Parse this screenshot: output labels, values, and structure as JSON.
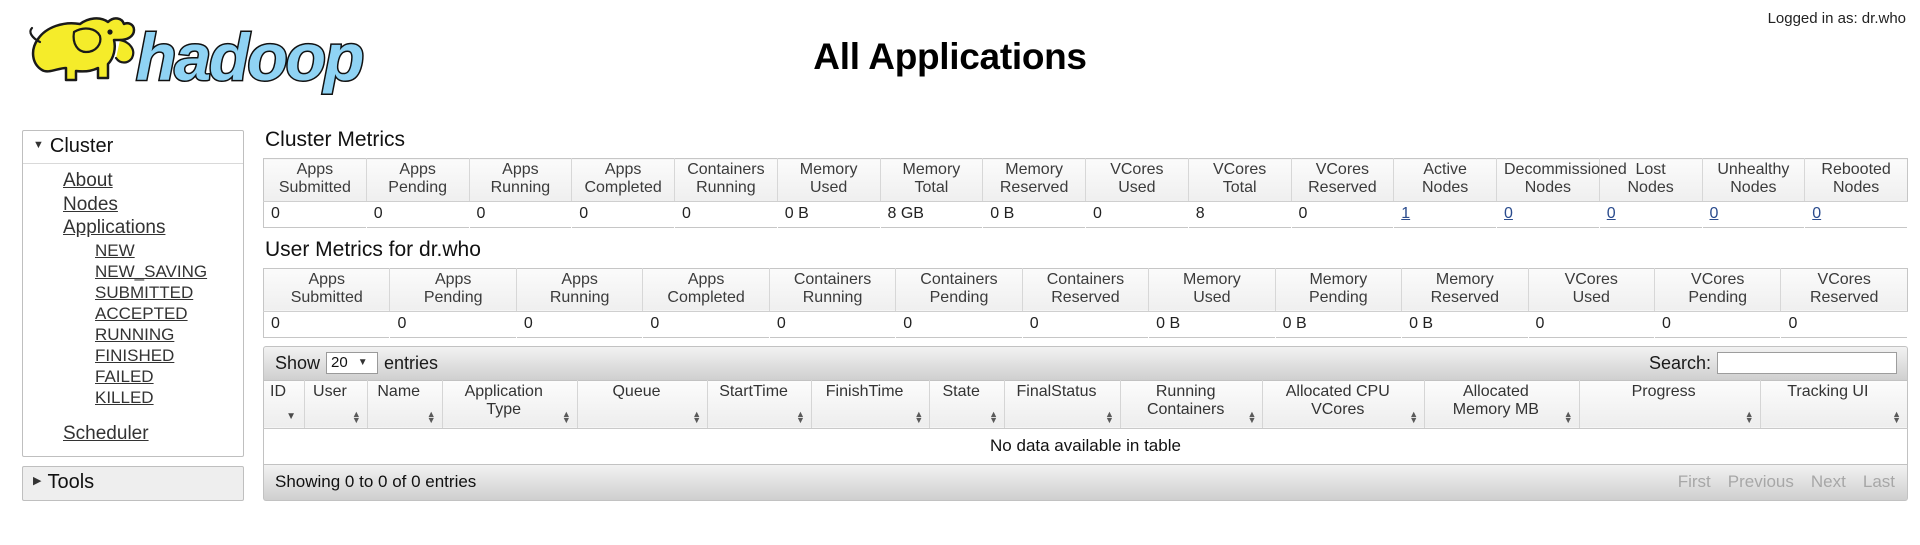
{
  "header": {
    "logged_in": "Logged in as: dr.who",
    "title": "All Applications",
    "logo_alt": "hadoop-logo"
  },
  "sidebar": {
    "cluster": {
      "label": "Cluster",
      "items": [
        {
          "label": "About"
        },
        {
          "label": "Nodes"
        },
        {
          "label": "Applications"
        }
      ],
      "app_states": [
        {
          "label": "NEW"
        },
        {
          "label": "NEW_SAVING"
        },
        {
          "label": "SUBMITTED"
        },
        {
          "label": "ACCEPTED"
        },
        {
          "label": "RUNNING"
        },
        {
          "label": "FINISHED"
        },
        {
          "label": "FAILED"
        },
        {
          "label": "KILLED"
        }
      ],
      "scheduler": {
        "label": "Scheduler"
      }
    },
    "tools": {
      "label": "Tools"
    }
  },
  "cluster_metrics": {
    "title": "Cluster Metrics",
    "columns": [
      "Apps Submitted",
      "Apps Pending",
      "Apps Running",
      "Apps Completed",
      "Containers Running",
      "Memory Used",
      "Memory Total",
      "Memory Reserved",
      "VCores Used",
      "VCores Total",
      "VCores Reserved",
      "Active Nodes",
      "Decommissioned Nodes",
      "Lost Nodes",
      "Unhealthy Nodes",
      "Rebooted Nodes"
    ],
    "columns_wrapped": [
      [
        "Apps",
        "Submitted"
      ],
      [
        "Apps",
        "Pending"
      ],
      [
        "Apps",
        "Running"
      ],
      [
        "Apps",
        "Completed"
      ],
      [
        "Containers",
        "Running"
      ],
      [
        "Memory",
        "Used"
      ],
      [
        "Memory",
        "Total"
      ],
      [
        "Memory",
        "Reserved"
      ],
      [
        "VCores",
        "Used"
      ],
      [
        "VCores",
        "Total"
      ],
      [
        "VCores",
        "Reserved"
      ],
      [
        "Active",
        "Nodes"
      ],
      [
        "Decommissioned",
        "Nodes"
      ],
      [
        "Lost",
        "Nodes"
      ],
      [
        "Unhealthy",
        "Nodes"
      ],
      [
        "Rebooted",
        "Nodes"
      ]
    ],
    "values": [
      "0",
      "0",
      "0",
      "0",
      "0",
      "0 B",
      "8 GB",
      "0 B",
      "0",
      "8",
      "0",
      "1",
      "0",
      "0",
      "0",
      "0"
    ],
    "link_columns": [
      11,
      12,
      13,
      14,
      15
    ]
  },
  "user_metrics": {
    "title": "User Metrics for dr.who",
    "columns": [
      "Apps Submitted",
      "Apps Pending",
      "Apps Running",
      "Apps Completed",
      "Containers Running",
      "Containers Pending",
      "Containers Reserved",
      "Memory Used",
      "Memory Pending",
      "Memory Reserved",
      "VCores Used",
      "VCores Pending",
      "VCores Reserved"
    ],
    "columns_wrapped": [
      [
        "Apps",
        "Submitted"
      ],
      [
        "Apps",
        "Pending"
      ],
      [
        "Apps",
        "Running"
      ],
      [
        "Apps",
        "Completed"
      ],
      [
        "Containers",
        "Running"
      ],
      [
        "Containers",
        "Pending"
      ],
      [
        "Containers",
        "Reserved"
      ],
      [
        "Memory",
        "Used"
      ],
      [
        "Memory",
        "Pending"
      ],
      [
        "Memory",
        "Reserved"
      ],
      [
        "VCores",
        "Used"
      ],
      [
        "VCores",
        "Pending"
      ],
      [
        "VCores",
        "Reserved"
      ]
    ],
    "values": [
      "0",
      "0",
      "0",
      "0",
      "0",
      "0",
      "0",
      "0 B",
      "0 B",
      "0 B",
      "0",
      "0",
      "0"
    ]
  },
  "datatable": {
    "show_label": "Show",
    "entries_label": "entries",
    "page_length": "20",
    "search_label": "Search:",
    "search_value": "",
    "columns": [
      {
        "label": "ID",
        "wrapped": [
          "ID"
        ],
        "sort": "desc"
      },
      {
        "label": "User",
        "wrapped": [
          "User"
        ],
        "sort": "both"
      },
      {
        "label": "Name",
        "wrapped": [
          "Name"
        ],
        "sort": "both"
      },
      {
        "label": "Application Type",
        "wrapped": [
          "Application",
          "Type"
        ],
        "sort": "both"
      },
      {
        "label": "Queue",
        "wrapped": [
          "Queue"
        ],
        "sort": "both"
      },
      {
        "label": "StartTime",
        "wrapped": [
          "StartTime"
        ],
        "sort": "both"
      },
      {
        "label": "FinishTime",
        "wrapped": [
          "FinishTime"
        ],
        "sort": "both"
      },
      {
        "label": "State",
        "wrapped": [
          "State"
        ],
        "sort": "both"
      },
      {
        "label": "FinalStatus",
        "wrapped": [
          "FinalStatus"
        ],
        "sort": "both"
      },
      {
        "label": "Running Containers",
        "wrapped": [
          "Running",
          "Containers"
        ],
        "sort": "both"
      },
      {
        "label": "Allocated CPU VCores",
        "wrapped": [
          "Allocated CPU",
          "VCores"
        ],
        "sort": "both"
      },
      {
        "label": "Allocated Memory MB",
        "wrapped": [
          "Allocated",
          "Memory MB"
        ],
        "sort": "both"
      },
      {
        "label": "Progress",
        "wrapped": [
          "Progress"
        ],
        "sort": "both"
      },
      {
        "label": "Tracking UI",
        "wrapped": [
          "Tracking UI"
        ],
        "sort": "both"
      }
    ],
    "empty_message": "No data available in table",
    "info": "Showing 0 to 0 of 0 entries",
    "paginate": [
      "First",
      "Previous",
      "Next",
      "Last"
    ]
  },
  "colors": {
    "link": "#2a4b8d",
    "logo_yellow": "#f5ec2a",
    "logo_blue": "#8fd3f4",
    "panel_border": "#bfbfbf"
  }
}
